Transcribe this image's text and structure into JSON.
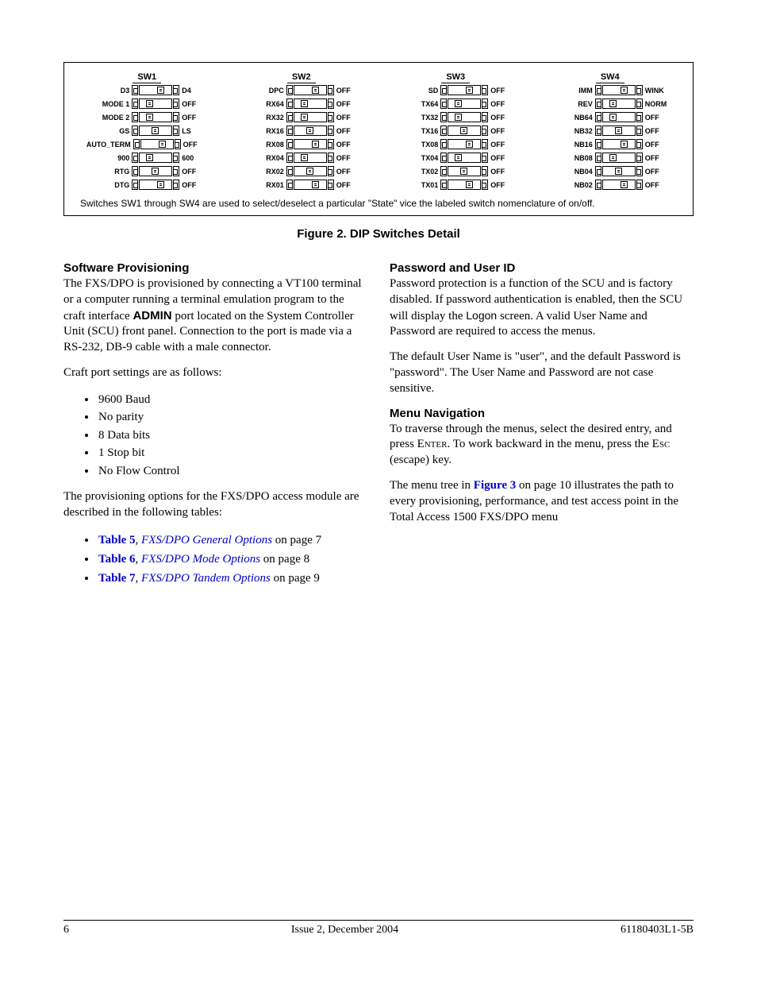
{
  "dip": {
    "note": "Switches SW1 through SW4 are used to select/deselect a particular \"State\" vice the labeled switch nomenclature of on/off.",
    "columns": [
      {
        "title": "SW1",
        "rows": [
          {
            "left": "D3",
            "right": "D4",
            "pos": 3
          },
          {
            "left": "MODE 1",
            "right": "OFF",
            "pos": 1
          },
          {
            "left": "MODE 2",
            "right": "OFF",
            "pos": 1
          },
          {
            "left": "GS",
            "right": "LS",
            "pos": 2
          },
          {
            "left": "AUTO_TERM",
            "right": "OFF",
            "pos": 3
          },
          {
            "left": "900",
            "right": "600",
            "pos": 1
          },
          {
            "left": "RTG",
            "right": "OFF",
            "pos": 2
          },
          {
            "left": "DTG",
            "right": "OFF",
            "pos": 3
          }
        ]
      },
      {
        "title": "SW2",
        "rows": [
          {
            "left": "DPC",
            "right": "OFF",
            "pos": 3
          },
          {
            "left": "RX64",
            "right": "OFF",
            "pos": 1
          },
          {
            "left": "RX32",
            "right": "OFF",
            "pos": 1
          },
          {
            "left": "RX16",
            "right": "OFF",
            "pos": 2
          },
          {
            "left": "RX08",
            "right": "OFF",
            "pos": 3
          },
          {
            "left": "RX04",
            "right": "OFF",
            "pos": 1
          },
          {
            "left": "RX02",
            "right": "OFF",
            "pos": 2
          },
          {
            "left": "RX01",
            "right": "OFF",
            "pos": 3
          }
        ]
      },
      {
        "title": "SW3",
        "rows": [
          {
            "left": "SD",
            "right": "OFF",
            "pos": 3
          },
          {
            "left": "TX64",
            "right": "OFF",
            "pos": 1
          },
          {
            "left": "TX32",
            "right": "OFF",
            "pos": 1
          },
          {
            "left": "TX16",
            "right": "OFF",
            "pos": 2
          },
          {
            "left": "TX08",
            "right": "OFF",
            "pos": 3
          },
          {
            "left": "TX04",
            "right": "OFF",
            "pos": 1
          },
          {
            "left": "TX02",
            "right": "OFF",
            "pos": 2
          },
          {
            "left": "TX01",
            "right": "OFF",
            "pos": 3
          }
        ]
      },
      {
        "title": "SW4",
        "rows": [
          {
            "left": "IMM",
            "right": "WINK",
            "pos": 3
          },
          {
            "left": "REV",
            "right": "NORM",
            "pos": 1
          },
          {
            "left": "NB64",
            "right": "OFF",
            "pos": 1
          },
          {
            "left": "NB32",
            "right": "OFF",
            "pos": 2
          },
          {
            "left": "NB16",
            "right": "OFF",
            "pos": 3
          },
          {
            "left": "NB08",
            "right": "OFF",
            "pos": 1
          },
          {
            "left": "NB04",
            "right": "OFF",
            "pos": 2
          },
          {
            "left": "NB02",
            "right": "OFF",
            "pos": 3
          }
        ]
      }
    ]
  },
  "caption": "Figure 2.  DIP Switches Detail",
  "left": {
    "heading": "Software Provisioning",
    "p1a": "The FXS/DPO is provisioned by connecting a VT100 terminal or a computer running a terminal emulation program to the craft interface ",
    "p1admin": "ADMIN",
    "p1b": " port located on the System Controller Unit (SCU) front panel. Connection to the port is made via a RS-232, DB-9 cable with a male connector.",
    "p2": "Craft port settings are as follows:",
    "bullets": [
      "9600 Baud",
      "No parity",
      "8 Data bits",
      "1 Stop bit",
      "No Flow Control"
    ],
    "p3": "The provisioning options for the FXS/DPO access module are described in the following tables:",
    "refs": [
      {
        "bold": "Table 5",
        "sep": ", ",
        "italic": "FXS/DPO General Options",
        "tail": " on page 7"
      },
      {
        "bold": "Table 6",
        "sep": ", ",
        "italic": "FXS/DPO Mode Options",
        "tail": " on page 8"
      },
      {
        "bold": "Table 7",
        "sep": ", ",
        "italic": "FXS/DPO Tandem Options",
        "tail": " on page 9"
      }
    ]
  },
  "right": {
    "h1": "Password and User ID",
    "p1a": "Password protection is a function of the SCU and is factory disabled. If password authentication is enabled, then the SCU will display the ",
    "p1logon": "Logon",
    "p1b": " screen. A valid User Name and Password are required to access the menus.",
    "p2": "The default User Name is \"user\", and the default Password is \"password\". The User Name and Password are not case sensitive.",
    "h2": "Menu Navigation",
    "p3a": "To traverse through the menus, select the desired entry, and press ",
    "enter": "Enter",
    "p3b": ". To work backward in the menu, press the ",
    "esc": "Esc",
    "p3c": " (escape) key.",
    "p4a": "The menu tree in ",
    "p4ref": "Figure 3",
    "p4b": " on page 10 illustrates the path to every provisioning, performance, and test access point in the Total Access 1500 FXS/DPO menu"
  },
  "footer": {
    "left": "6",
    "center": "Issue 2, December 2004",
    "right": "61180403L1-5B"
  }
}
